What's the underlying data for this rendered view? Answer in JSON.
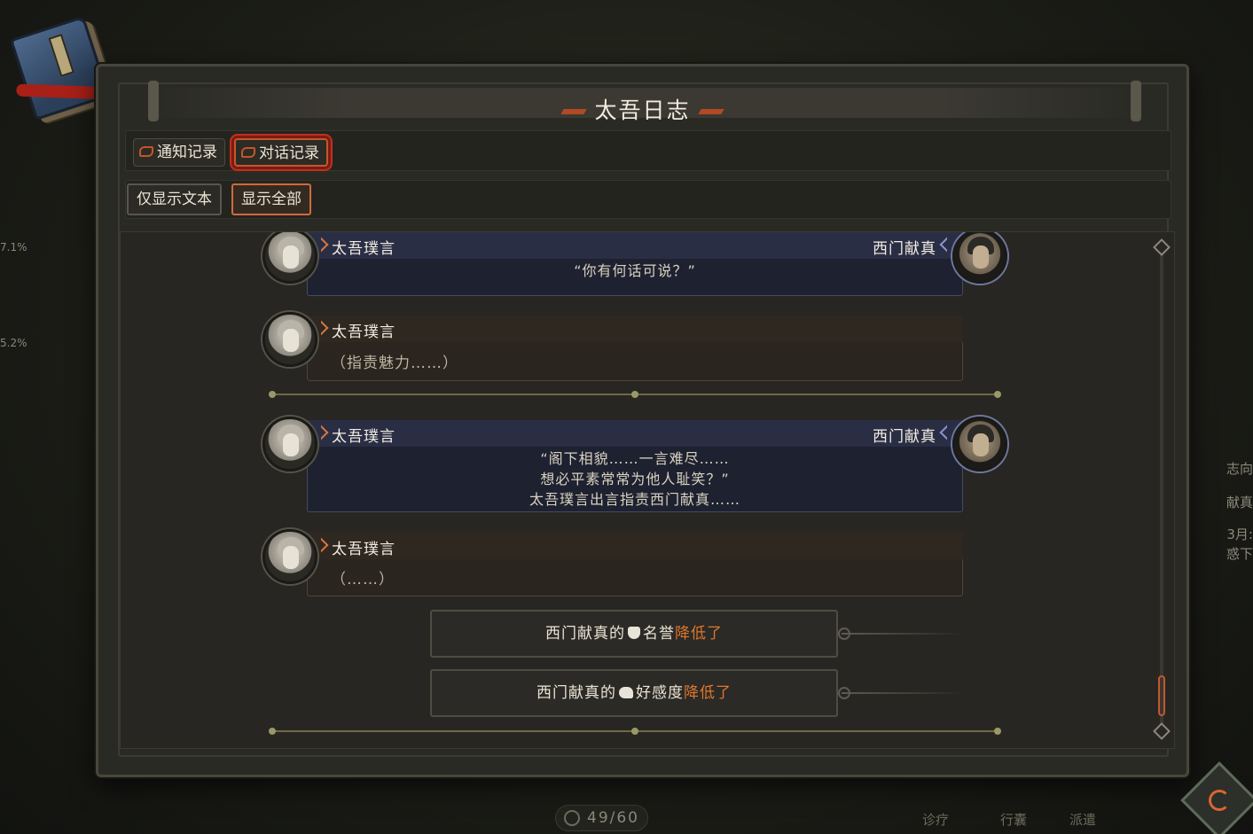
{
  "window": {
    "title": "太吾日志"
  },
  "tabs": [
    {
      "label": "通知记录",
      "active": false
    },
    {
      "label": "对话记录",
      "active": true
    }
  ],
  "filters": [
    {
      "label": "仅显示文本",
      "active": false
    },
    {
      "label": "显示全部",
      "active": true
    }
  ],
  "messages": [
    {
      "type": "dialog",
      "speaker": "太吾璞言",
      "target": "西门献真",
      "lines": [
        "“你有何话可说？”"
      ]
    },
    {
      "type": "monolog",
      "speaker": "太吾璞言",
      "text": "（指责魅力……）"
    },
    {
      "type": "dialog",
      "speaker": "太吾璞言",
      "target": "西门献真",
      "lines": [
        "“阁下相貌……一言难尽……",
        "想必平素常常为他人耻笑？”",
        "太吾璞言出言指责西门献真……"
      ]
    },
    {
      "type": "monolog",
      "speaker": "太吾璞言",
      "text": "（……）"
    }
  ],
  "notices": [
    {
      "prefix": "西门献真的",
      "icon": "reputation-icon",
      "stat": "名誉",
      "change": "降低了"
    },
    {
      "prefix": "西门献真的",
      "icon": "favor-icon",
      "stat": "好感度",
      "change": "降低了"
    }
  ],
  "background": {
    "left_percent_1": "7.1%",
    "left_percent_2": "5.2%",
    "right_note_1": "志向",
    "right_note_2": "献真",
    "right_note_3": "3月:",
    "right_note_4": "惑下",
    "bottom_buttons": [
      "诊疗",
      "行囊",
      "派遣"
    ],
    "counter": "49/60"
  },
  "colors": {
    "accent": "#c4572e",
    "decrease": "#e0762e",
    "dialog_bg": "#1e2130",
    "monolog_bg": "#2a251e"
  }
}
